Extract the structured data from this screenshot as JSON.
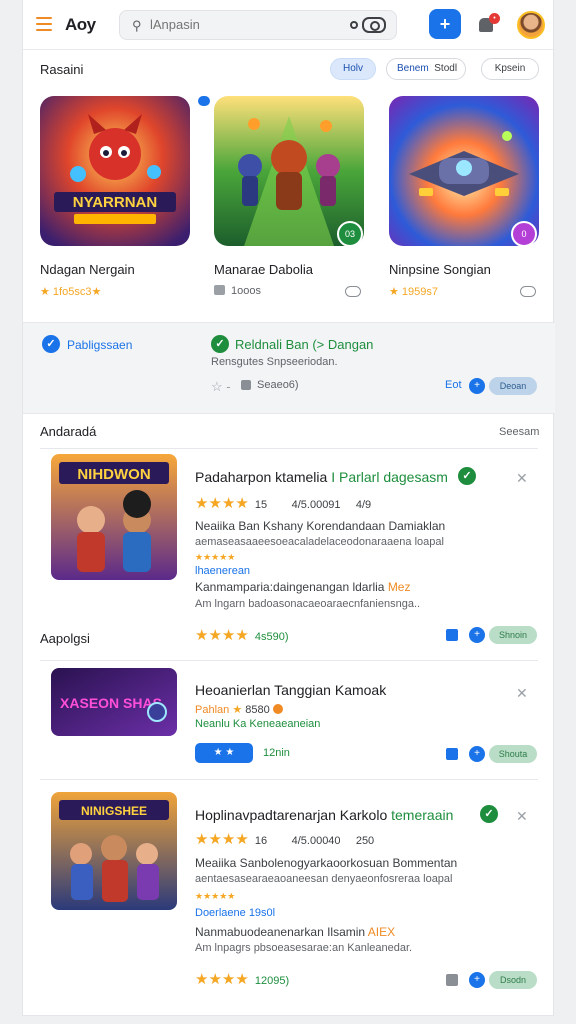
{
  "header": {
    "brand": "Aoy",
    "search_placeholder": "lAnpasin"
  },
  "featured": {
    "title": "Rasaini",
    "chips": [
      "Holv",
      "Benem",
      "Stodl",
      "Kpsein"
    ],
    "tiles": [
      {
        "name": "Ndagan Nergain",
        "meta": "★ 1fo5sc3★",
        "art_text": "NYARRNAN"
      },
      {
        "name": "Manarae Dabolia",
        "meta": "1ooos",
        "badge": "03"
      },
      {
        "name": "Ninpsine Songian",
        "meta": "★ 1959s7",
        "badge": "0"
      }
    ]
  },
  "panel": {
    "left_label": "Pabligssaen",
    "right_label": "Reldnali Ban (> Dangan",
    "sub_text": "Rensgutes Snpseeriodan.",
    "meta": "Seaeo6)",
    "link": "Eot",
    "button": "Deoan"
  },
  "list": {
    "title": "Andaradá",
    "see_all": "Seesam",
    "section2_title": "Aapolgsi",
    "items": [
      {
        "title": "Padaharpon ktamelia",
        "title_accent": "I Parlarl dagesasm",
        "stars": "★★★★",
        "meta": "15        4/5.00091     4/9",
        "line1": "Neaiika Ban Kshany Korendandaan Damiaklan",
        "line2": "aemaseasaaeesoeacaladelaceodonaraaena loapal",
        "stars_small": "★★★★★",
        "blue_line": "lhaenerean",
        "line3_a": "Kanmamparia:daingenangan ldarlia",
        "line3_b": "Mez",
        "line4": "Am lngarn badoasonacaeoaraecnfaniensnga..",
        "bottom_stars": "★★★★",
        "bottom_count": "4s590)",
        "button": "Shnoin",
        "art_text": "NIHDWON"
      },
      {
        "title": "Heoanierlan Tanggian Kamoak",
        "meta_a": "Pahlan",
        "meta_b": "8580",
        "blue_line": "Neanlu Ka Keneaeaneian",
        "pill": "★ ★",
        "count": "12nin",
        "button": "Shouta",
        "art_text": "XASEON SHAS"
      },
      {
        "title": "Hoplinavpadtarenarjan Karkolo",
        "title_accent": "temeraain",
        "stars": "★★★★",
        "meta": "16        4/5.00040     250",
        "line1": "Meaiika Sanbolenogyarkaoorkosuan Bommentan",
        "line2": "aentaesasearaeaoaneesan denyaeonfosreraa loapal",
        "stars_small": "★★★★★",
        "blue_line": "Doerlaene 19s0l",
        "line3_a": "Nanmabuodeanenarkan Ilsamin",
        "line3_b": "AIEX",
        "line4": "Am lnpagrs pbsoeasesarae:an Kanleanedar.",
        "bottom_stars": "★★★★",
        "bottom_count": "12095)",
        "button": "Dsodn",
        "art_text": "NINIGSHEE"
      }
    ]
  },
  "colors": {
    "accent_blue": "#1a73e8",
    "accent_green": "#1e8e3e",
    "star": "#f5a623",
    "menu_orange": "#f08a24"
  }
}
